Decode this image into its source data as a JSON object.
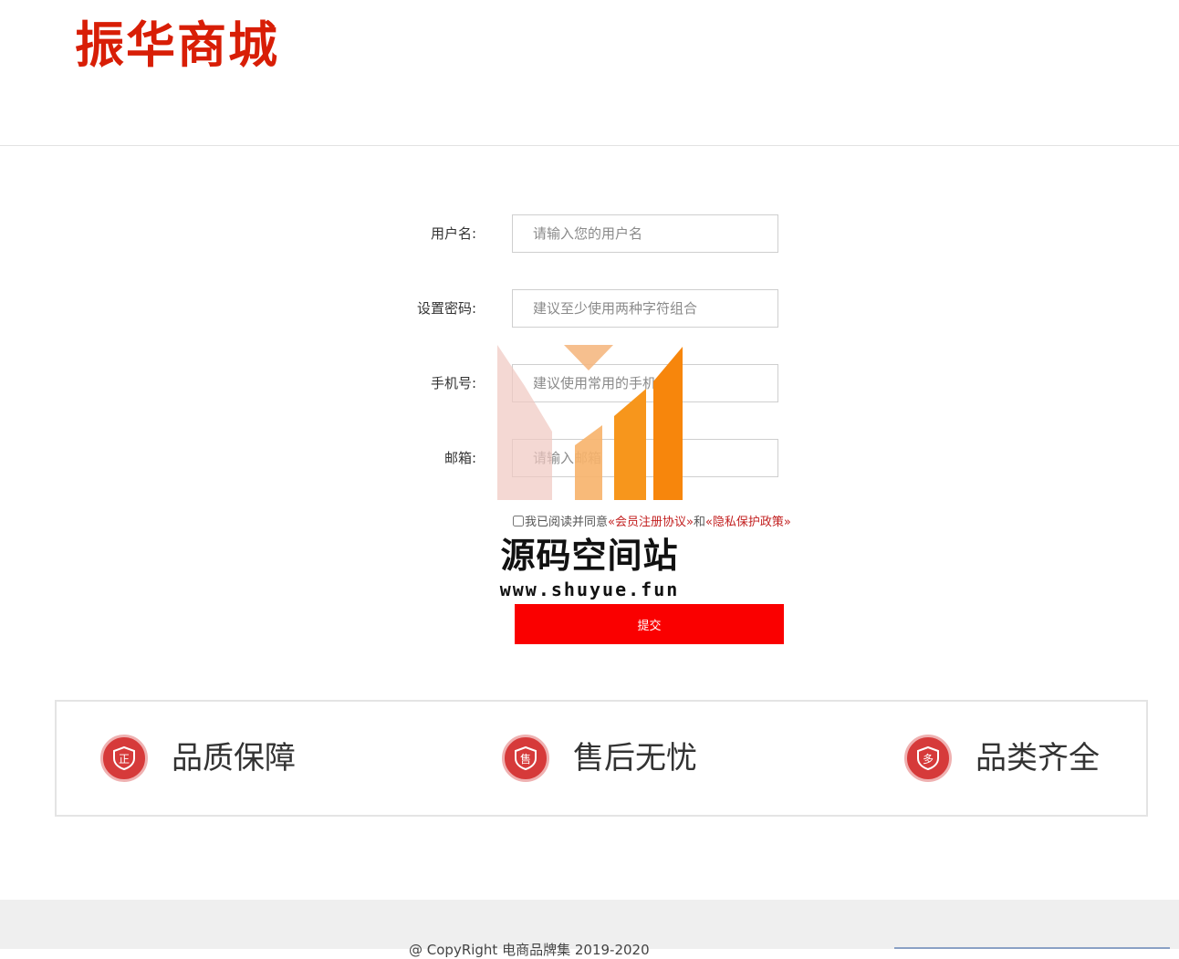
{
  "header": {
    "logo_text": "振华商城"
  },
  "form": {
    "fields": [
      {
        "label": "用户名:",
        "placeholder": "请输入您的用户名"
      },
      {
        "label": "设置密码:",
        "placeholder": "建议至少使用两种字符组合"
      },
      {
        "label": "手机号:",
        "placeholder": "建议使用常用的手机号"
      },
      {
        "label": "邮箱:",
        "placeholder": "请输入邮箱"
      }
    ],
    "agreement": {
      "prefix": "我已阅读并同意",
      "terms_link": "«会员注册协议»",
      "and": "和",
      "privacy_link": "«隐私保护政策»"
    },
    "submit_label": "提交"
  },
  "watermark": {
    "title": "源码空间站",
    "url": "www.shuyue.fun"
  },
  "features": [
    {
      "icon": "shield-zheng-icon",
      "icon_char": "正",
      "label": "品质保障"
    },
    {
      "icon": "shield-shou-icon",
      "icon_char": "售",
      "label": "售后无忧"
    },
    {
      "icon": "shield-duo-icon",
      "icon_char": "多",
      "label": "品类齐全"
    }
  ],
  "footer": {
    "copyright": "@ CopyRight 电商品牌集 2019-2020"
  },
  "colors": {
    "brand_red": "#d81e06",
    "button_red": "#fa0000",
    "link_red": "#c21f1f",
    "icon_red": "#d63a3a"
  }
}
